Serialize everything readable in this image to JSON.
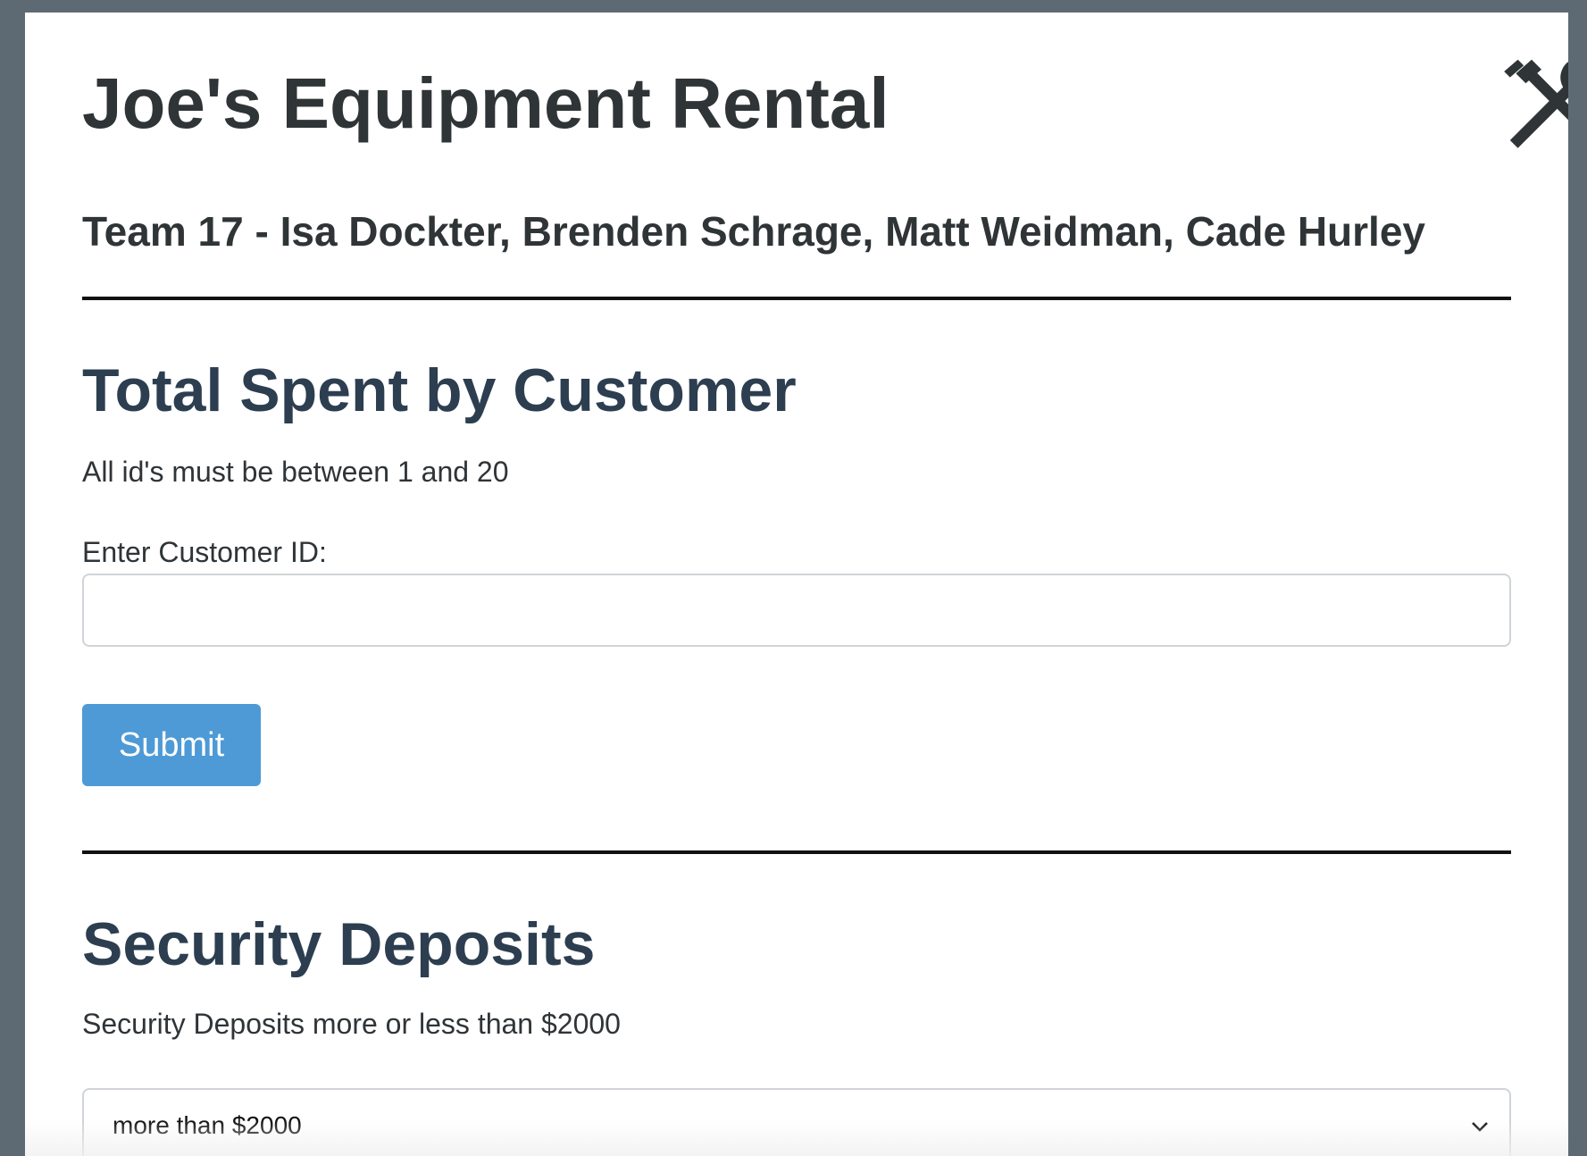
{
  "header": {
    "title": "Joe's Equipment Rental",
    "team_line": "Team 17 - Isa Dockter, Brenden Schrage, Matt Weidman, Cade Hurley",
    "icon": "tools-icon"
  },
  "total_spent": {
    "heading": "Total Spent by Customer",
    "help_text": "All id's must be between 1 and 20",
    "input_label": "Enter Customer ID:",
    "input_value": "",
    "input_placeholder": "",
    "submit_label": "Submit"
  },
  "security_deposits": {
    "heading": "Security Deposits",
    "help_text": "Security Deposits more or less than $2000",
    "selected_option": "more than $2000",
    "icon": "chevron-down-icon"
  },
  "colors": {
    "page_background": "#5d6a74",
    "heading_color": "#2c3e50",
    "button_color": "#4d9ad6"
  }
}
